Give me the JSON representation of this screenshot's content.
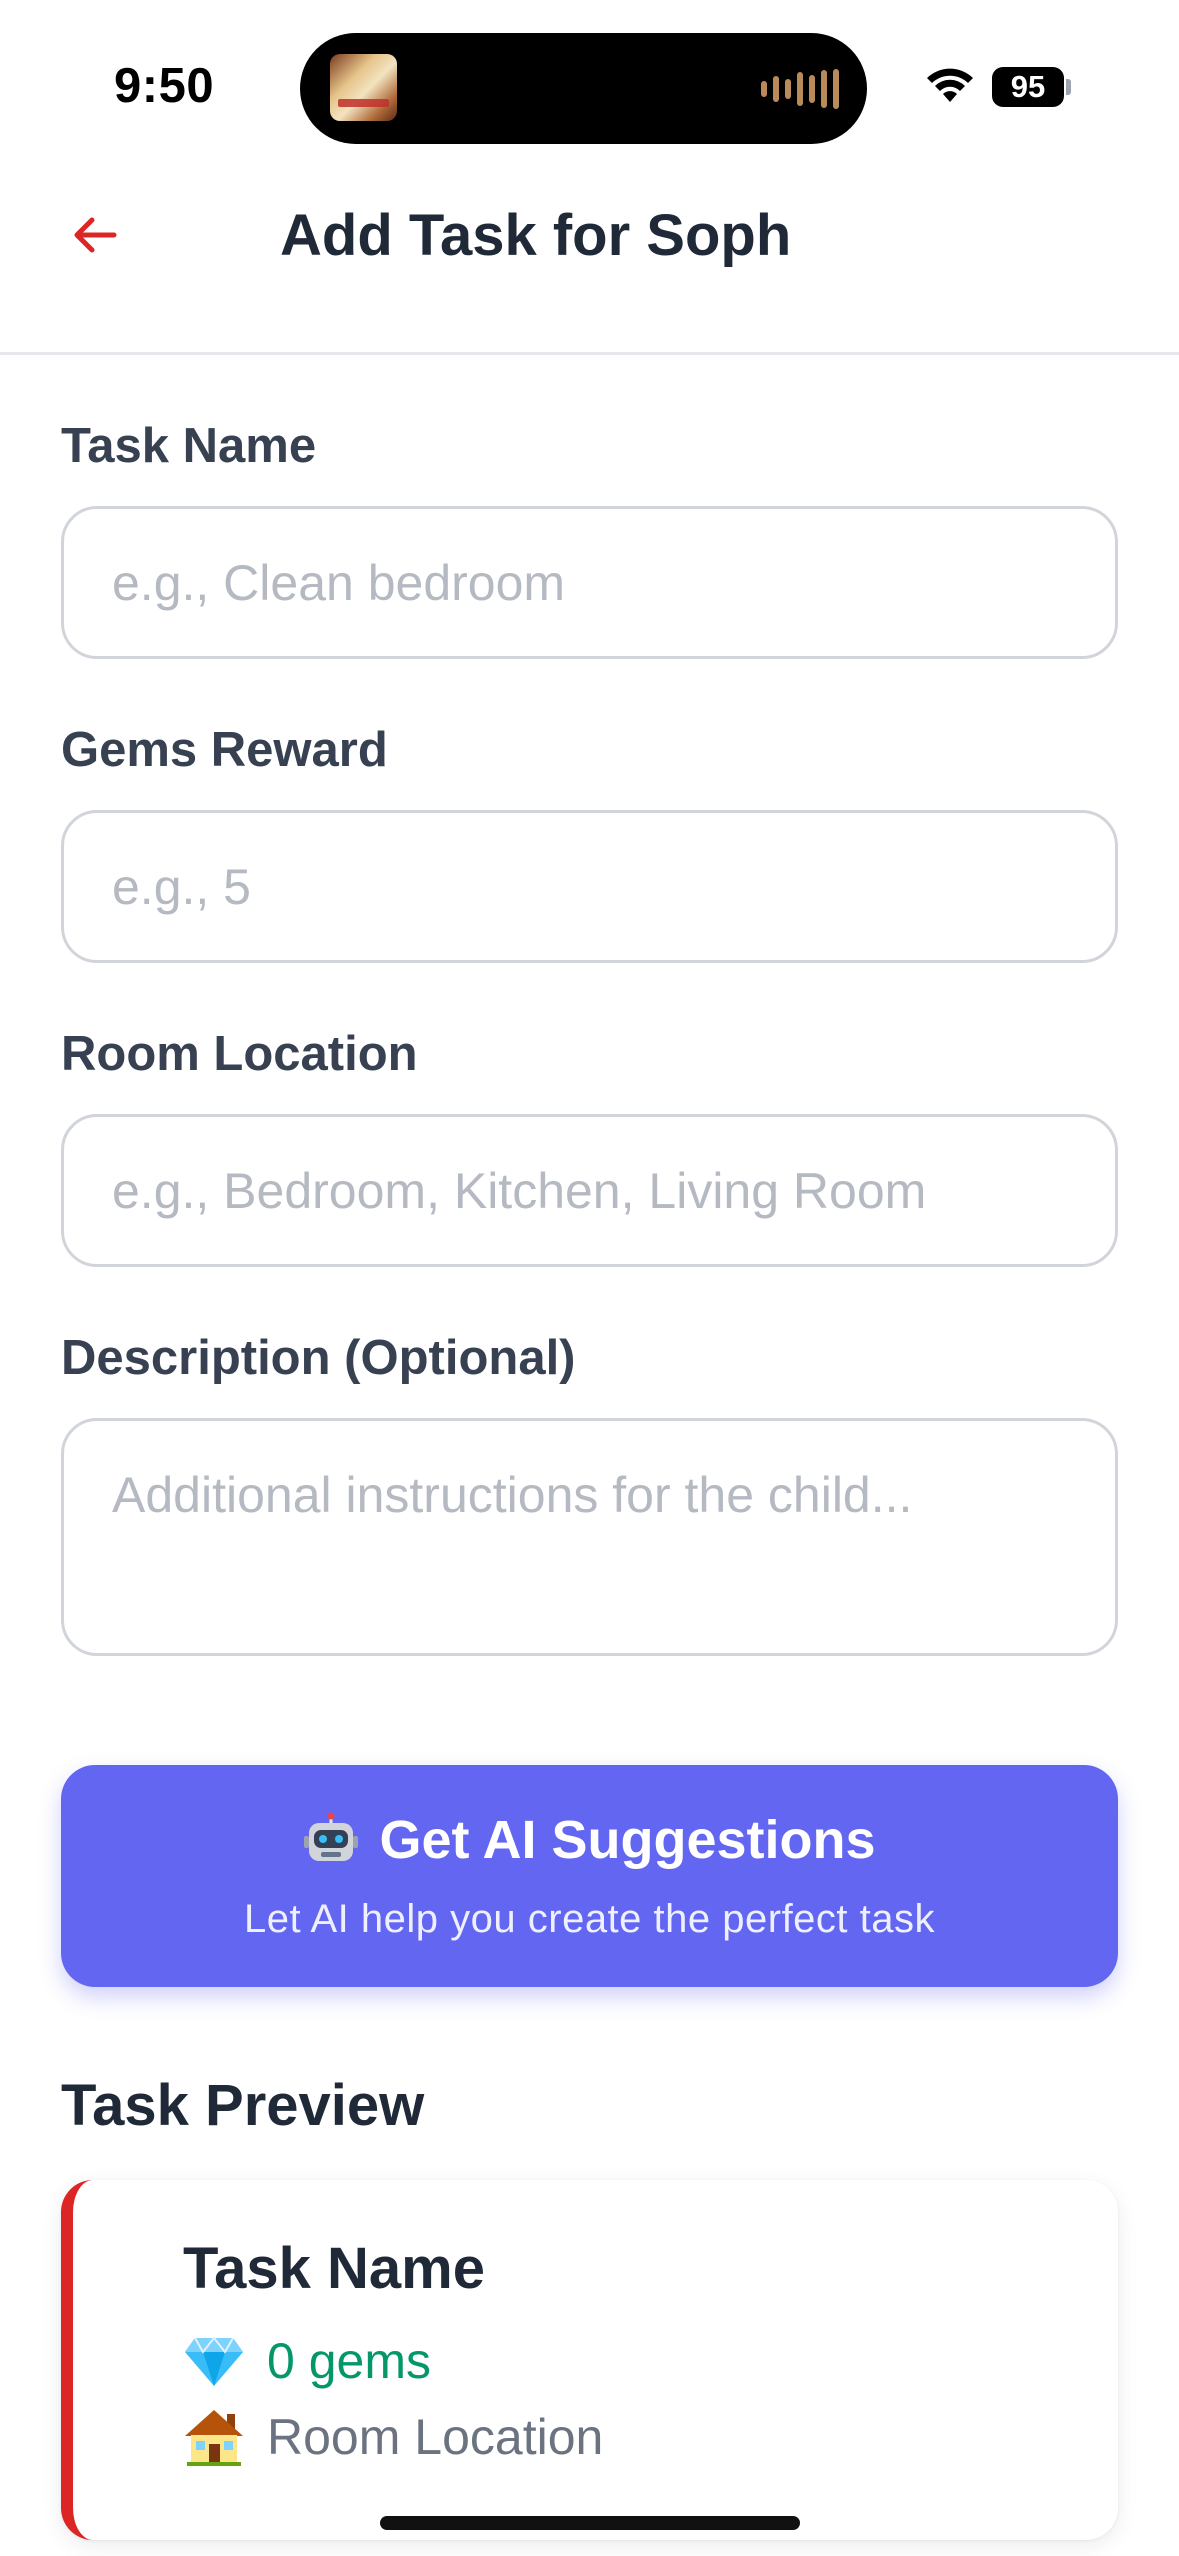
{
  "status_bar": {
    "time": "9:50",
    "battery": "95",
    "icons": [
      "now-playing-album-art",
      "audio-waveform-icon",
      "wifi-icon",
      "battery-icon"
    ]
  },
  "header": {
    "back_icon": "arrow-left-icon",
    "title": "Add Task for Soph"
  },
  "form": {
    "task_name": {
      "label": "Task Name",
      "value": "",
      "placeholder": "e.g., Clean bedroom"
    },
    "gems_reward": {
      "label": "Gems Reward",
      "value": "",
      "placeholder": "e.g., 5"
    },
    "room_location": {
      "label": "Room Location",
      "value": "",
      "placeholder": "e.g., Bedroom, Kitchen, Living Room"
    },
    "description": {
      "label": "Description (Optional)",
      "value": "",
      "placeholder": "Additional instructions for the child..."
    }
  },
  "ai_button": {
    "icon": "robot-icon",
    "title": "Get AI Suggestions",
    "subtitle": "Let AI help you create the perfect task"
  },
  "preview": {
    "heading": "Task Preview",
    "task_name": "Task Name",
    "gems_icon": "gem-icon",
    "gems_text": "0 gems",
    "room_icon": "house-icon",
    "room_text": "Room Location"
  },
  "colors": {
    "accent": "#6366f1",
    "back_arrow": "#dc2626",
    "card_border": "#dc2626",
    "gems_text": "#059669",
    "placeholder": "#b4b9c2"
  }
}
